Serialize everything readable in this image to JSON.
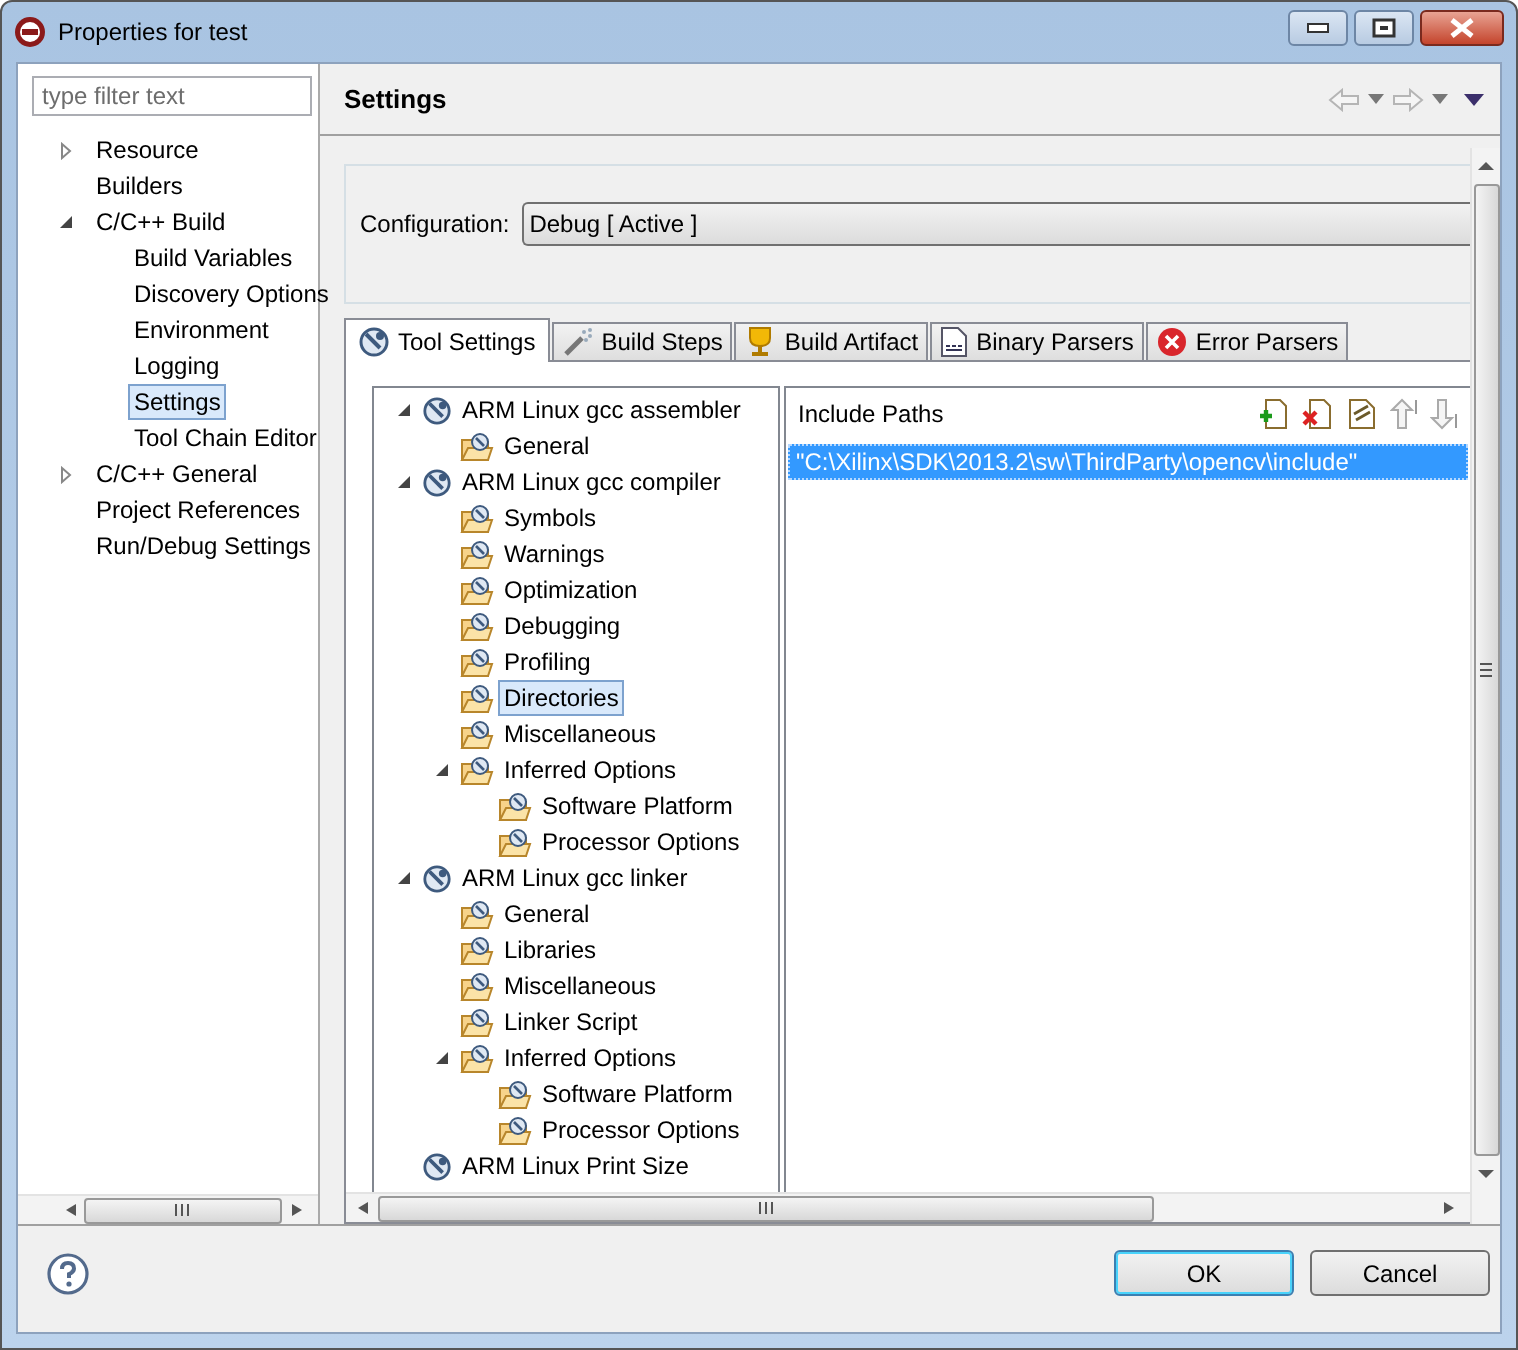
{
  "window": {
    "title": "Properties for test"
  },
  "filter": {
    "placeholder": "type filter text"
  },
  "nav_tree": [
    {
      "label": "Resource",
      "expanded": false,
      "selected": false
    },
    {
      "label": "Builders",
      "selected": false
    },
    {
      "label": "C/C++ Build",
      "expanded": true,
      "selected": false,
      "children": [
        {
          "label": "Build Variables",
          "selected": false
        },
        {
          "label": "Discovery Options",
          "selected": false
        },
        {
          "label": "Environment",
          "selected": false
        },
        {
          "label": "Logging",
          "selected": false
        },
        {
          "label": "Settings",
          "selected": true
        },
        {
          "label": "Tool Chain Editor",
          "selected": false
        }
      ]
    },
    {
      "label": "C/C++ General",
      "expanded": false,
      "selected": false
    },
    {
      "label": "Project References",
      "selected": false
    },
    {
      "label": "Run/Debug Settings",
      "selected": false
    }
  ],
  "page_title": "Settings",
  "configuration": {
    "label": "Configuration:",
    "value": "Debug  [ Active ]"
  },
  "tabs": [
    {
      "label": "Tool Settings",
      "selected": true,
      "kind": "tool"
    },
    {
      "label": "Build Steps",
      "selected": false,
      "kind": "steps"
    },
    {
      "label": "Build Artifact",
      "selected": false,
      "kind": "artifact"
    },
    {
      "label": "Binary Parsers",
      "selected": false,
      "kind": "binary"
    },
    {
      "label": "Error Parsers",
      "selected": false,
      "kind": "error"
    }
  ],
  "tool_tree": [
    {
      "label": "ARM Linux gcc assembler",
      "kind": "tool",
      "expanded": true,
      "selected": false,
      "children": [
        {
          "label": "General",
          "kind": "option",
          "selected": false
        }
      ]
    },
    {
      "label": "ARM Linux gcc compiler",
      "kind": "tool",
      "expanded": true,
      "selected": false,
      "children": [
        {
          "label": "Symbols",
          "kind": "option",
          "selected": false
        },
        {
          "label": "Warnings",
          "kind": "option",
          "selected": false
        },
        {
          "label": "Optimization",
          "kind": "option",
          "selected": false
        },
        {
          "label": "Debugging",
          "kind": "option",
          "selected": false
        },
        {
          "label": "Profiling",
          "kind": "option",
          "selected": false
        },
        {
          "label": "Directories",
          "kind": "option",
          "selected": true
        },
        {
          "label": "Miscellaneous",
          "kind": "option",
          "selected": false
        },
        {
          "label": "Inferred Options",
          "kind": "option",
          "expanded": true,
          "selected": false,
          "children": [
            {
              "label": "Software Platform",
              "kind": "option",
              "selected": false
            },
            {
              "label": "Processor Options",
              "kind": "option",
              "selected": false
            }
          ]
        }
      ]
    },
    {
      "label": "ARM Linux gcc linker",
      "kind": "tool",
      "expanded": true,
      "selected": false,
      "children": [
        {
          "label": "General",
          "kind": "option",
          "selected": false
        },
        {
          "label": "Libraries",
          "kind": "option",
          "selected": false
        },
        {
          "label": "Miscellaneous",
          "kind": "option",
          "selected": false
        },
        {
          "label": "Linker Script",
          "kind": "option",
          "selected": false
        },
        {
          "label": "Inferred Options",
          "kind": "option",
          "expanded": true,
          "selected": false,
          "children": [
            {
              "label": "Software Platform",
              "kind": "option",
              "selected": false
            },
            {
              "label": "Processor Options",
              "kind": "option",
              "selected": false
            }
          ]
        }
      ]
    },
    {
      "label": "ARM Linux Print Size",
      "kind": "tool",
      "selected": false
    }
  ],
  "include_paths": {
    "title": "Include Paths",
    "items": [
      {
        "text": "\"C:\\Xilinx\\SDK\\2013.2\\sw\\ThirdParty\\opencv\\include\"",
        "selected": true
      }
    ]
  },
  "buttons": [
    {
      "label": "OK",
      "default": true
    },
    {
      "label": "Cancel",
      "default": false
    }
  ]
}
